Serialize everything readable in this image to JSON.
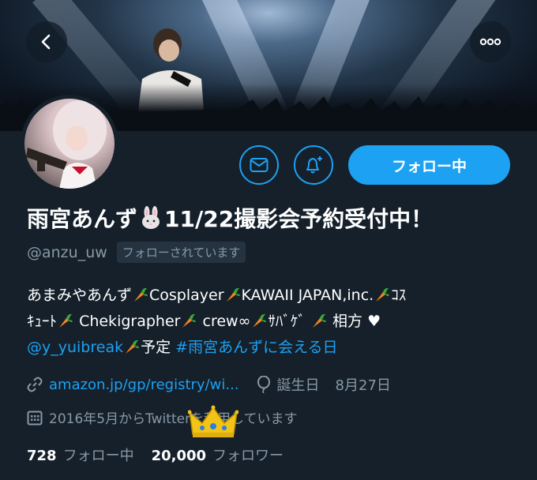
{
  "header": {
    "back_icon": "chevron-left-icon",
    "more_icon": "ellipsis-icon"
  },
  "actions": {
    "message_icon": "envelope-icon",
    "notify_icon": "bell-plus-icon",
    "follow_label": "フォロー中"
  },
  "profile": {
    "name_part1": "雨宮あんず",
    "name_part2": "11/22撮影会予約受付中！",
    "handle": "@anzu_uw",
    "follows_you": "フォローされています"
  },
  "bio": {
    "t1": "あまみやあんず",
    "t2": "Cosplayer",
    "t3": "KAWAII JAPAN,inc.",
    "t4": "ｺｽ",
    "t5": "ｷｭｰﾄ",
    "t6": "Chekigrapher",
    "t7": "crew∞",
    "t8": "ｻﾊﾞｹﾞ",
    "t9": "相方",
    "t10": "♥",
    "mention": "@y_yuibreak",
    "t11": "予定",
    "hashtag": "#雨宮あんずに会える日"
  },
  "meta": {
    "link_icon": "link-icon",
    "website": "amazon.jp/gp/registry/wi...",
    "birthday_icon": "balloon-icon",
    "birthday_label": "誕生日",
    "birthday_value": "8月27日",
    "calendar_icon": "calendar-icon",
    "joined": "2016年5月からTwitterを利用しています"
  },
  "stats": {
    "following_count": "728",
    "following_label": "フォロー中",
    "followers_count": "20,000",
    "followers_label": "フォロワー"
  },
  "colors": {
    "background": "#15202b",
    "accent": "#1da1f2",
    "muted": "#8899a6",
    "carrot": "#f5821f"
  }
}
